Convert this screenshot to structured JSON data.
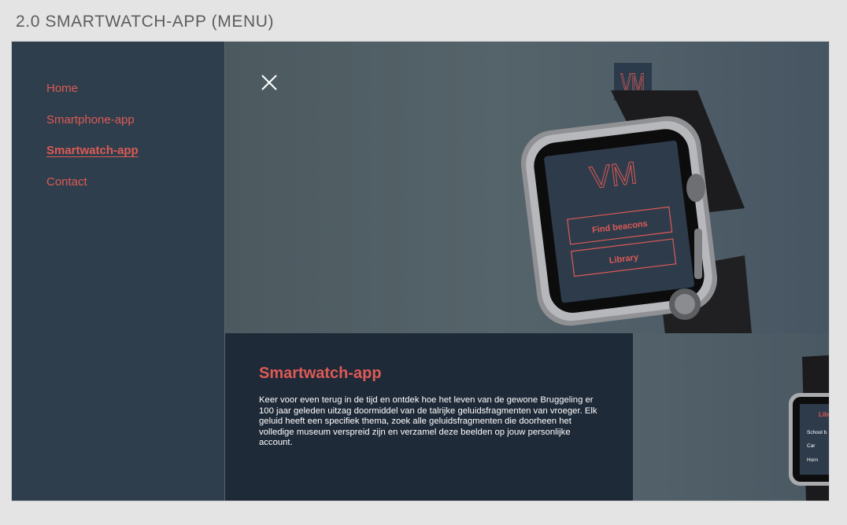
{
  "page": {
    "title": "2.0 SMARTWATCH-APP (MENU)"
  },
  "nav": {
    "items": [
      {
        "label": "Home",
        "active": false
      },
      {
        "label": "Smartphone-app",
        "active": false
      },
      {
        "label": "Smartwatch-app",
        "active": true
      },
      {
        "label": "Contact",
        "active": false
      }
    ]
  },
  "hero": {
    "logo_text": "VM",
    "watch_logo_text": "VM",
    "watch_buttons": [
      "Find beacons",
      "Library"
    ]
  },
  "section": {
    "title": "Smartwatch-app",
    "body": "Keer voor even terug in de tijd en ontdek hoe het leven van de gewone Bruggeling er 100 jaar geleden uitzag doormiddel van de talrijke geluidsfragmenten van vroeger. Elk geluid heeft een specifiek thema, zoek alle geluidsfragmenten die doorheen het volledige museum verspreid zijn en verzamel deze beelden op jouw personlijke account."
  },
  "mini_watch": {
    "title": "Libr",
    "items": [
      "School b",
      "Car",
      "Horn"
    ]
  },
  "colors": {
    "accent": "#de5a55",
    "sidebar": "#2e3e4c",
    "panel_dark": "#1f2a38",
    "page_bg": "#e4e4e4"
  },
  "icons": [
    "close-icon",
    "vm-logo"
  ]
}
